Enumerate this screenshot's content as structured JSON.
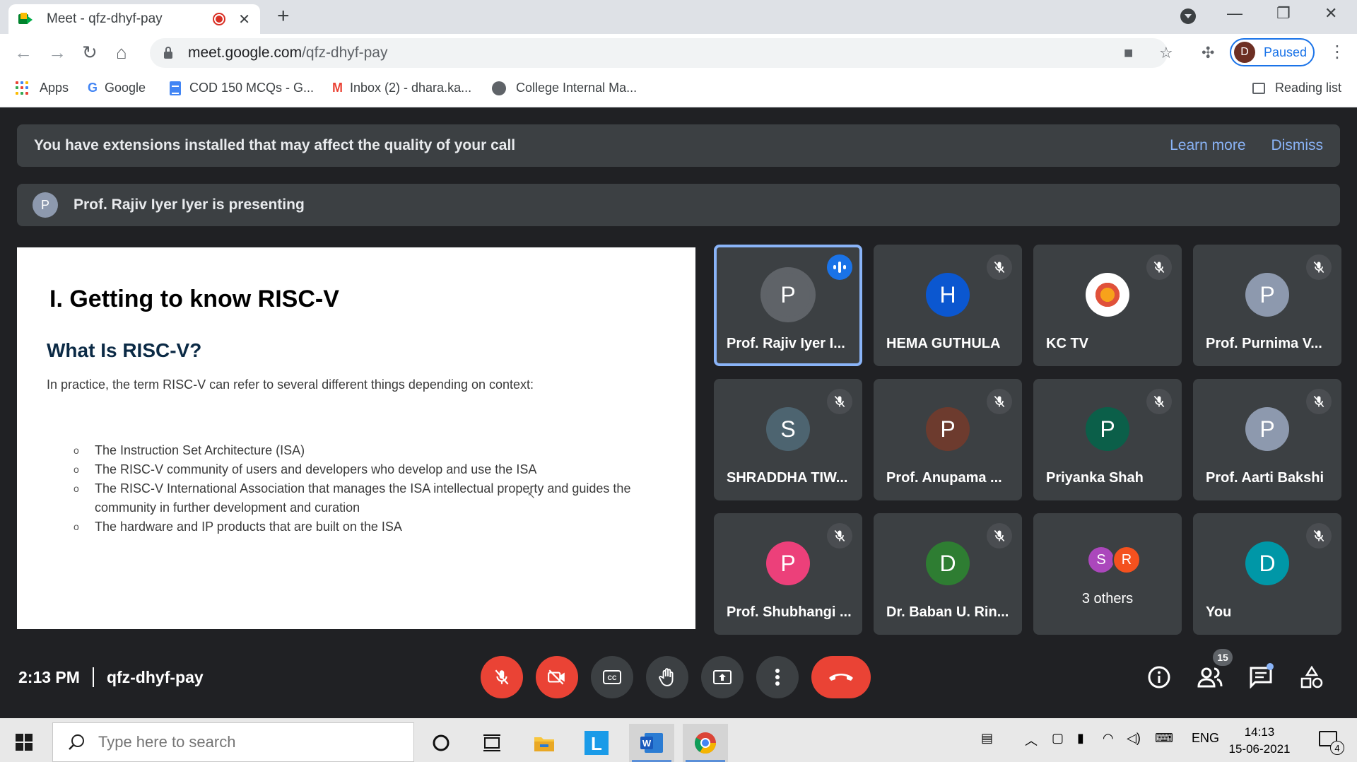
{
  "browser": {
    "tab_title": "Meet - qfz-dhyf-pay",
    "url_host": "meet.google.com",
    "url_path": "/qfz-dhyf-pay",
    "profile_initial": "D",
    "profile_status": "Paused"
  },
  "bookmarks": [
    {
      "label": "Apps",
      "icon": "apps-grid-icon"
    },
    {
      "label": "Google",
      "icon": "google-icon"
    },
    {
      "label": "COD 150 MCQs - G...",
      "icon": "docs-icon"
    },
    {
      "label": "Inbox (2) - dhara.ka...",
      "icon": "gmail-icon"
    },
    {
      "label": "College Internal Ma...",
      "icon": "globe-icon"
    }
  ],
  "reading_list": "Reading list",
  "banner": {
    "text": "You have extensions installed that may affect the quality of your call",
    "learn_more": "Learn more",
    "dismiss": "Dismiss"
  },
  "presenting": {
    "initial": "P",
    "text": "Prof. Rajiv Iyer Iyer is presenting"
  },
  "slide": {
    "heading": "I.  Getting to know RISC-V",
    "subheading": "What Is RISC-V?",
    "intro": "In practice, the term RISC-V can refer to several different things depending on context:",
    "bullet": "o",
    "items": [
      "The Instruction Set Architecture (ISA)",
      "The RISC-V community of users and developers who develop and use the ISA",
      "The RISC-V International Association that manages the ISA intellectual property and guides the community in further development and curation",
      "The hardware and IP products that are built on the ISA"
    ]
  },
  "participants": [
    {
      "name": "Prof. Rajiv Iyer I...",
      "initial": "P",
      "color": "#5f6368",
      "speaking": true
    },
    {
      "name": "HEMA GUTHULA",
      "initial": "H",
      "color": "#0b57d0"
    },
    {
      "name": "KC TV",
      "initial": "",
      "color": "#ffffff",
      "crest": true
    },
    {
      "name": "Prof. Purnima V...",
      "initial": "P",
      "color": "#8d99ae"
    },
    {
      "name": "SHRADDHA TIW...",
      "initial": "S",
      "color": "#4d6470"
    },
    {
      "name": "Prof. Anupama ...",
      "initial": "P",
      "color": "#6d3b2e"
    },
    {
      "name": "Priyanka Shah",
      "initial": "P",
      "color": "#0b5f49"
    },
    {
      "name": "Prof. Aarti Bakshi",
      "initial": "P",
      "color": "#8d99ae"
    },
    {
      "name": "Prof. Shubhangi ...",
      "initial": "P",
      "color": "#ec407a"
    },
    {
      "name": "Dr. Baban U. Rin...",
      "initial": "D",
      "color": "#2e7d32"
    },
    {
      "name": "You",
      "initial": "D",
      "color": "#0097a7"
    }
  ],
  "others": {
    "label": "3 others",
    "initials": [
      {
        "initial": "S",
        "color": "#ab47bc"
      },
      {
        "initial": "R",
        "color": "#f4511e"
      }
    ]
  },
  "meeting": {
    "time": "2:13 PM",
    "code": "qfz-dhyf-pay",
    "participant_count": "15"
  },
  "taskbar": {
    "search_placeholder": "Type here to search",
    "language": "ENG",
    "time": "14:13",
    "date": "15-06-2021",
    "notification_count": "4"
  }
}
